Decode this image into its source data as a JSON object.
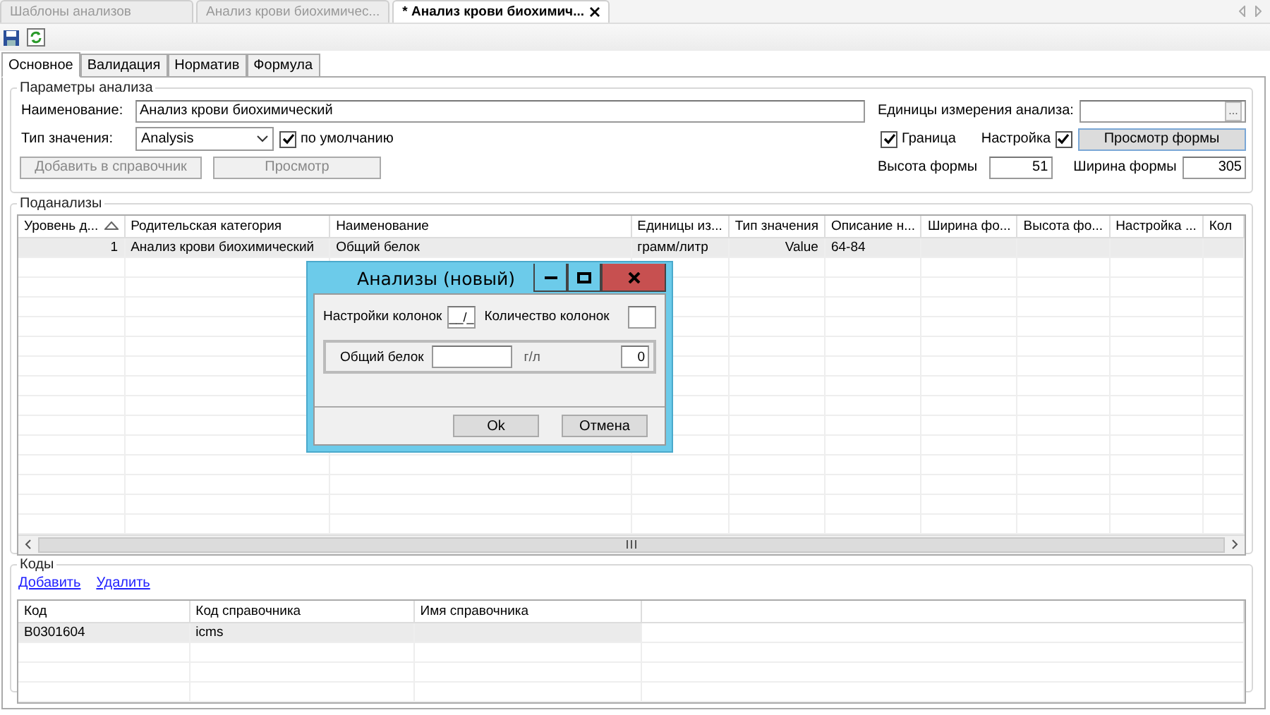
{
  "document_tabs": [
    {
      "label": "Шаблоны анализов",
      "selected": false
    },
    {
      "label": "Анализ крови биохимичес...",
      "selected": false
    },
    {
      "label": "* Анализ крови биохимич...",
      "selected": true
    }
  ],
  "tabs": [
    {
      "label": "Основное",
      "selected": true
    },
    {
      "label": "Валидация",
      "selected": false
    },
    {
      "label": "Норматив",
      "selected": false
    },
    {
      "label": "Формула",
      "selected": false
    }
  ],
  "params": {
    "title": "Параметры анализа",
    "name_label": "Наименование:",
    "name_value": "Анализ крови биохимический",
    "type_label": "Тип значения:",
    "type_value": "Analysis",
    "default_checkbox": {
      "label": "по умолчанию",
      "checked": true
    },
    "add_button": {
      "label": "Добавить в справочник",
      "disabled": true
    },
    "preview_button": {
      "label": "Просмотр",
      "disabled": true
    },
    "units_label": "Единицы измерения анализа:",
    "units_browse": "...",
    "border_checkbox": {
      "label": "Граница",
      "checked": true
    },
    "setting_checkbox": {
      "label": "Настройка",
      "checked": true
    },
    "form_preview_button": "Просмотр формы",
    "height_label": "Высота формы",
    "height_value": "51",
    "width_label": "Ширина формы",
    "width_value": "305"
  },
  "subanalyses": {
    "title": "Поданализы",
    "columns": [
      {
        "label": "Уровень д...",
        "sorted": true
      },
      {
        "label": "Родительская категория",
        "sorted": false
      },
      {
        "label": "Наименование",
        "sorted": false
      },
      {
        "label": "Единицы из...",
        "sorted": false
      },
      {
        "label": "Тип значения",
        "sorted": false
      },
      {
        "label": "Описание н...",
        "sorted": false
      },
      {
        "label": "Ширина фо...",
        "sorted": false
      },
      {
        "label": "Высота фо...",
        "sorted": false
      },
      {
        "label": "Настройка ...",
        "sorted": false
      },
      {
        "label": "Кол",
        "sorted": false
      }
    ],
    "rows": [
      {
        "selected": true,
        "cells": [
          "1",
          "Анализ крови биохимический",
          "Общий белок",
          "грамм/литр",
          "Value",
          "64-84"
        ]
      }
    ]
  },
  "codes": {
    "title": "Коды",
    "links": [
      "Добавить",
      "Удалить"
    ],
    "columns": [
      "Код",
      "Код справочника",
      "Имя справочника"
    ],
    "rows": [
      {
        "selected": true,
        "cells": [
          "B0301604",
          "icms"
        ]
      }
    ]
  },
  "dialog": {
    "title": "Анализы (новый)",
    "columns_setting_label": "Настройки колонок",
    "columns_setting_value": "__/_",
    "columns_count_label": "Количество колонок",
    "fields": [
      {
        "label": "Общий белок",
        "unit": "г/л",
        "value": "0"
      }
    ],
    "ok": "Ok",
    "cancel": "Отмена"
  }
}
